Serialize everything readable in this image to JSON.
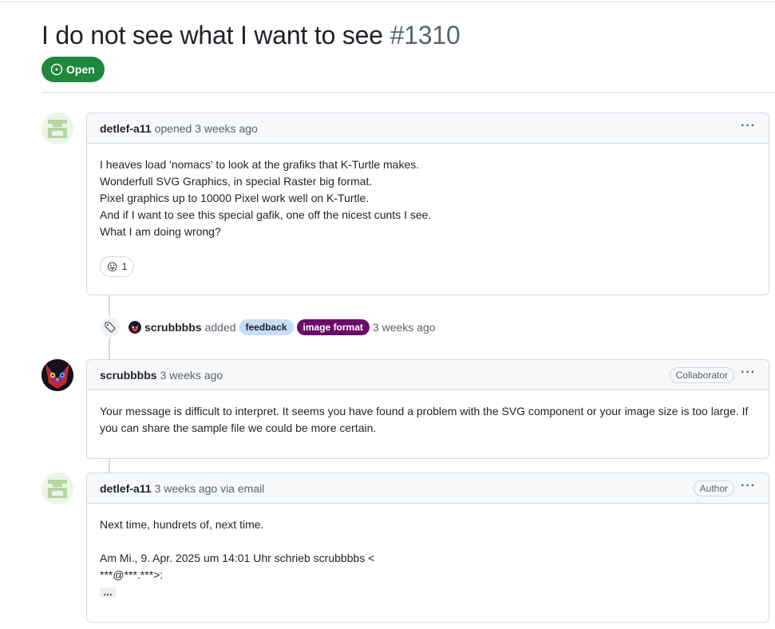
{
  "issue": {
    "title": "I do not see what I want to see",
    "number": "#1310",
    "state": "Open"
  },
  "comments": [
    {
      "author": "detlef-a11",
      "meta": "opened 3 weeks ago",
      "body": [
        "I heaves load 'nomacs' to look at the grafiks that K-Turtle makes.",
        "Wonderfull SVG Graphics, in special Raster big format.",
        "Pixel graphics up to 10000 Pixel work well on K-Turtle.",
        "And if I want to see this special gafik, one off the nicest cunts I see.",
        "What I am doing wrong?"
      ],
      "reaction_count": "1",
      "reaction_emoji": "😛"
    },
    {
      "author": "scrubbbbs",
      "meta": "3 weeks ago",
      "role": "Collaborator",
      "body": [
        "Your message is difficult to interpret. It seems you have found a problem with the SVG component or your image size is too large. If",
        "you can share the sample file we could be more certain."
      ]
    },
    {
      "author": "detlef-a11",
      "meta": "3 weeks ago via email",
      "role": "Author",
      "body": [
        "Next time, hundrets of, next time.",
        "Am Mi., 9. Apr. 2025 um 14:01 Uhr schrieb scrubbbbs <",
        "***@***.***>:"
      ],
      "expander": "…"
    }
  ],
  "event": {
    "actor": "scrubbbbs",
    "action": "added",
    "labels": [
      {
        "name": "feedback",
        "bg": "#c5def5",
        "fg": "#1f2328"
      },
      {
        "name": "image format",
        "bg": "#6b0a6b",
        "fg": "#ffffff"
      }
    ],
    "time": "3 weeks ago"
  },
  "colors": {
    "open_green": "#1f883d",
    "border": "#d1d9e0",
    "muted": "#59636e"
  }
}
